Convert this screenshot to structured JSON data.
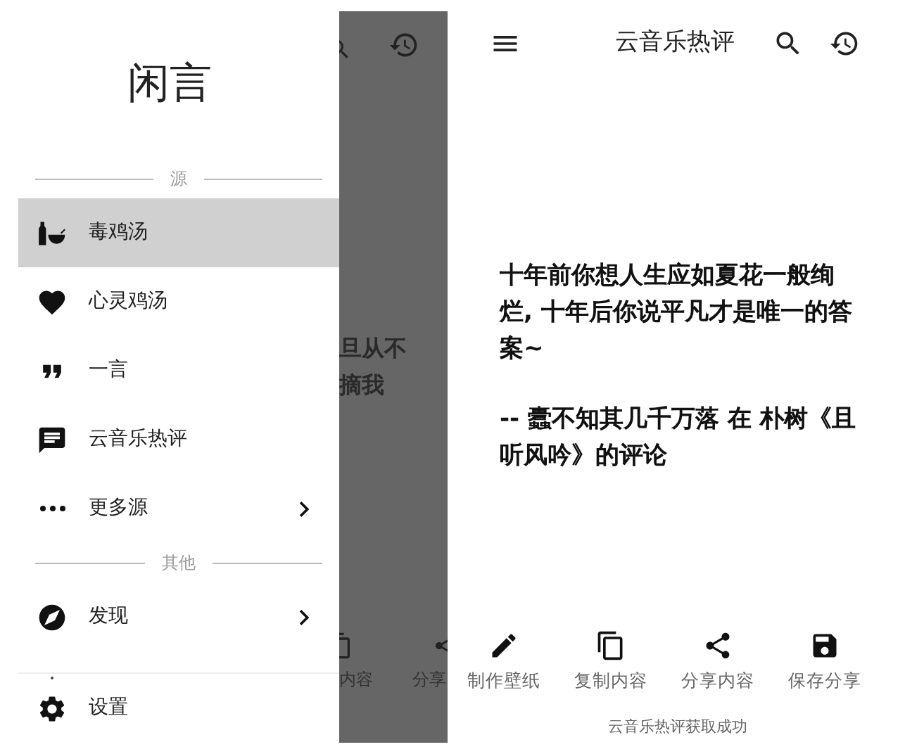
{
  "drawer": {
    "title": "闲言",
    "sections": [
      {
        "label": "源",
        "items": [
          {
            "label": "毒鸡汤",
            "kind": "bottle",
            "selected": true,
            "has_arrow": false
          },
          {
            "label": "心灵鸡汤",
            "kind": "heart",
            "selected": false,
            "has_arrow": false
          },
          {
            "label": "一言",
            "kind": "quote",
            "selected": false,
            "has_arrow": false
          },
          {
            "label": "云音乐热评",
            "kind": "message",
            "selected": false,
            "has_arrow": false
          },
          {
            "label": "更多源",
            "kind": "more",
            "selected": false,
            "has_arrow": true
          }
        ]
      },
      {
        "label": "其他",
        "items": [
          {
            "label": "发现",
            "kind": "compass",
            "selected": false,
            "has_arrow": true
          }
        ]
      }
    ],
    "footer_items": [
      {
        "label": "设置",
        "kind": "settings",
        "selected": false,
        "has_arrow": false
      }
    ]
  },
  "behind_drawer": {
    "texts": [
      "旦从不",
      "摘我"
    ],
    "action_labels": [
      "内容",
      "分享"
    ]
  },
  "app": {
    "title": "云音乐热评",
    "quote": "十年前你想人生应如夏花一般绚烂, 十年后你说平凡才是唯一的答案~",
    "attribution": "-- 蠹不知其几千万落 在 朴树《且听风吟》的评论",
    "actions": [
      {
        "label": "制作壁纸",
        "kind": "pencil"
      },
      {
        "label": "复制内容",
        "kind": "copy"
      },
      {
        "label": "分享内容",
        "kind": "share"
      },
      {
        "label": "保存分享",
        "kind": "save"
      }
    ],
    "toast": "云音乐热评获取成功"
  }
}
